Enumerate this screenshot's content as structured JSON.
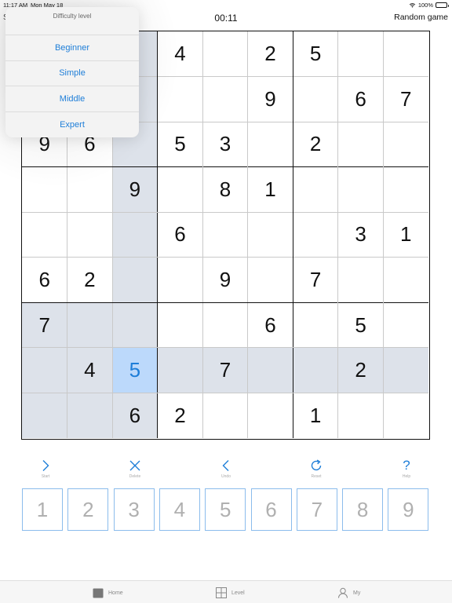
{
  "status_bar": {
    "time": "11:17 AM",
    "date": "Mon May 18",
    "battery": "100%"
  },
  "header": {
    "left_peek": "S",
    "timer": "00:11",
    "random_game_label": "Random game"
  },
  "difficulty_menu": {
    "title": "Difficulty level",
    "options": [
      "Beginner",
      "Simple",
      "Middle",
      "Expert"
    ]
  },
  "board": {
    "cells": [
      [
        "",
        "",
        "",
        "4",
        "",
        "2",
        "5",
        "",
        ""
      ],
      [
        "",
        "",
        "",
        "",
        "",
        "9",
        "",
        "6",
        "7"
      ],
      [
        "9",
        "6",
        "",
        "5",
        "3",
        "",
        "2",
        "",
        ""
      ],
      [
        "",
        "",
        "9",
        "",
        "8",
        "1",
        "",
        "",
        ""
      ],
      [
        "",
        "",
        "",
        "6",
        "",
        "",
        "",
        "3",
        "1"
      ],
      [
        "6",
        "2",
        "",
        "",
        "9",
        "",
        "7",
        "",
        ""
      ],
      [
        "7",
        "",
        "",
        "",
        "",
        "6",
        "",
        "5",
        ""
      ],
      [
        "",
        "4",
        "5",
        "",
        "7",
        "",
        "",
        "2",
        ""
      ],
      [
        "",
        "",
        "6",
        "2",
        "",
        "",
        "1",
        "",
        ""
      ]
    ],
    "selected": {
      "row": 7,
      "col": 2
    },
    "colors": {
      "highlight": "#dde2ea",
      "selected": "#bcd9fb",
      "selected_digit": "#1e7ed8"
    }
  },
  "toolbar": {
    "start": {
      "label": "Start",
      "icon": "chevron-right-icon"
    },
    "delete": {
      "label": "Delete",
      "icon": "close-icon"
    },
    "undo": {
      "label": "Undo",
      "icon": "chevron-left-icon"
    },
    "reset": {
      "label": "Reset",
      "icon": "refresh-icon"
    },
    "help": {
      "label": "Help",
      "icon": "question-icon",
      "glyph": "?"
    }
  },
  "numpad": {
    "keys": [
      "1",
      "2",
      "3",
      "4",
      "5",
      "6",
      "7",
      "8",
      "9"
    ]
  },
  "tabbar": {
    "tabs": [
      {
        "label": "Home",
        "icon": "folder-icon"
      },
      {
        "label": "Level",
        "icon": "grid-icon"
      },
      {
        "label": "My",
        "icon": "person-icon"
      }
    ]
  },
  "accent_color": "#1e7ed8"
}
